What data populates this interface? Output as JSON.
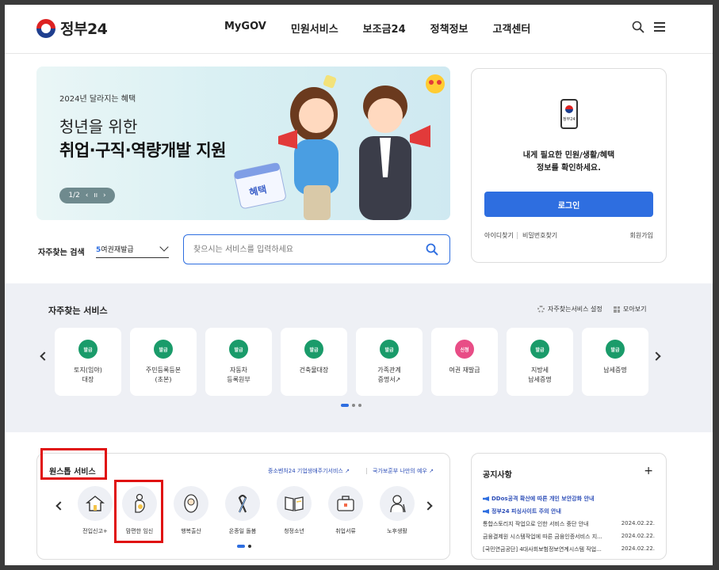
{
  "header": {
    "logo_text": "정부24",
    "nav": [
      "MyGOV",
      "민원서비스",
      "보조금24",
      "정책정보",
      "고객센터"
    ]
  },
  "banner": {
    "eyebrow": "2024년 달라지는 혜택",
    "title_line1": "청년을 위한",
    "title_line2": "취업·구직·역량개발 지원",
    "pager": "1/2",
    "sign_text": "혜택"
  },
  "login": {
    "phone_label": "정부24",
    "message_line1": "내게 필요한 민원/생활/혜택",
    "message_line2": "정보를 확인하세요.",
    "button": "로그인",
    "find_id": "아이디찾기",
    "find_pw": "비밀번호찾기",
    "signup": "회원가입"
  },
  "search": {
    "label": "자주찾는 검색",
    "select_num": "5",
    "select_text": "여권재발급",
    "placeholder": "찾으시는 서비스를 입력하세요"
  },
  "frequent": {
    "title": "자주찾는 서비스",
    "setting": "자주찾는서비스 설정",
    "view_all": "모아보기",
    "items": [
      {
        "badge": "발급",
        "label": "토지(임야)\n대장"
      },
      {
        "badge": "발급",
        "label": "주민등록등본\n(초본)"
      },
      {
        "badge": "발급",
        "label": "자동차\n등록원부"
      },
      {
        "badge": "발급",
        "label": "건축물대장"
      },
      {
        "badge": "발급",
        "label": "가족관계\n증명서↗"
      },
      {
        "badge": "신청",
        "label": "여권 재발급"
      },
      {
        "badge": "발급",
        "label": "지방세\n납세증명"
      },
      {
        "badge": "발급",
        "label": "납세증명"
      }
    ]
  },
  "onestop": {
    "title": "원스톱 서비스",
    "link1": "중소벤처24 기업생애주기서비스 ↗",
    "link2": "국가보훈부 나만의 예우 ↗",
    "items": [
      "전입신고+",
      "맘편한 임신",
      "행복출산",
      "온종일 돌봄",
      "청정소년",
      "취업서류",
      "노후생활"
    ]
  },
  "notice": {
    "title": "공지사항",
    "plus": "+",
    "rows": [
      {
        "text": "DDos공격 확산에 따른 개인 보안강화 안내",
        "date": "",
        "highlight": true
      },
      {
        "text": "정부24 피싱사이트 주의 안내",
        "date": "",
        "highlight": true
      },
      {
        "text": "통합스토리지 작업으로 인한 서비스 중단 안내",
        "date": "2024.02.22.",
        "highlight": false
      },
      {
        "text": "금융결제원 시스템작업에 따른 금융인증서비스 지...",
        "date": "2024.02.22.",
        "highlight": false
      },
      {
        "text": "[국민연금공단] 4대사회보험정보연계시스템 작업...",
        "date": "2024.02.22.",
        "highlight": false
      }
    ]
  },
  "colors": {
    "primary": "#2e6ee0",
    "badge_green": "#1a9b6a",
    "badge_pink": "#e84d86",
    "highlight_red": "#e01010"
  }
}
